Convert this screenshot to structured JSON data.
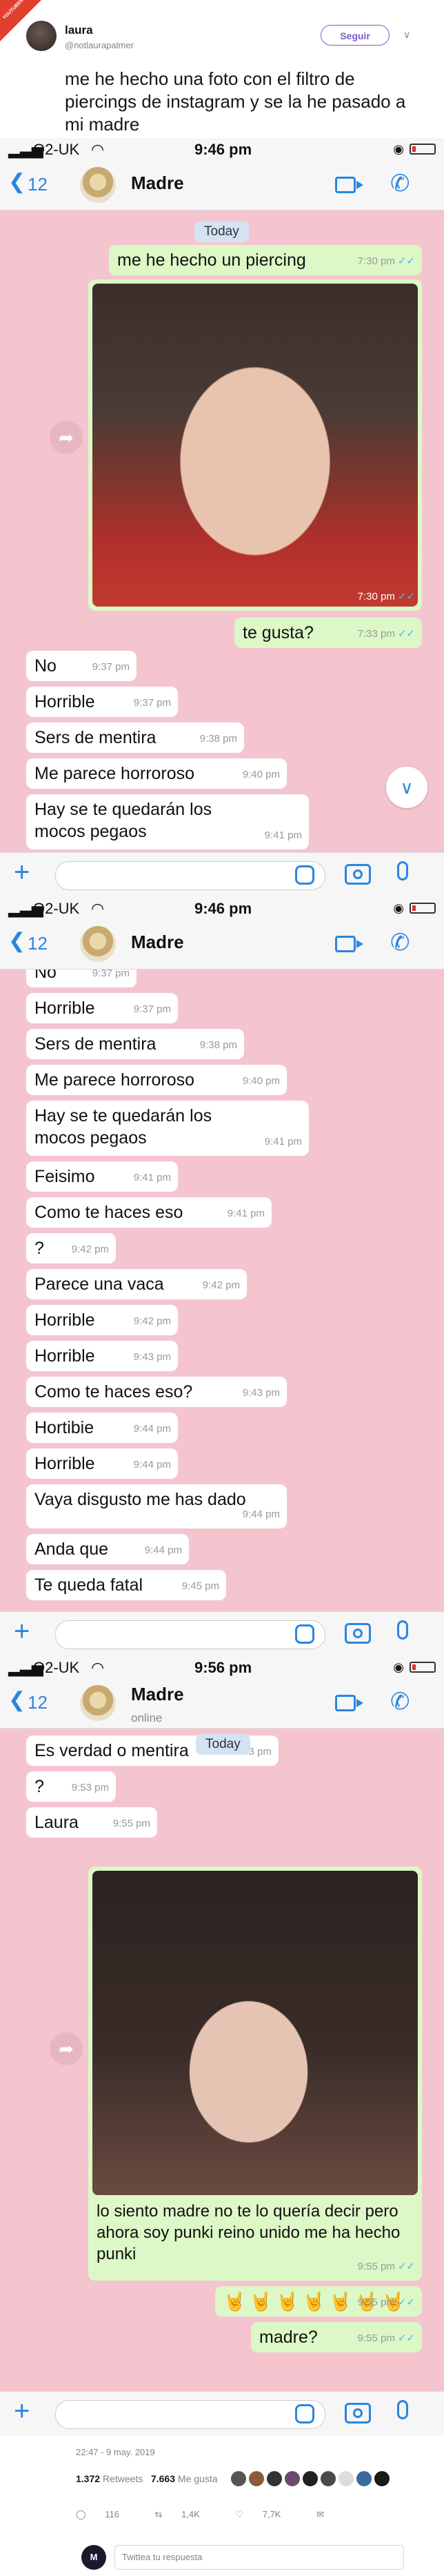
{
  "tweet": {
    "site_tag": "YOUTUBER.ES",
    "user_name": "laura",
    "handle": "@notlaurapalmer",
    "follow_label": "Seguir",
    "text": "me he hecho una foto con el filtro de piercings de instagram y se la he pasado a mi madre"
  },
  "screens": [
    {
      "carrier": "O2-UK",
      "time": "9:46 pm",
      "back_count": "12",
      "contact": "Madre",
      "contact_sub": "",
      "today": "Today",
      "messages": [
        {
          "text": "me he hecho un piercing",
          "time": "7:30 pm"
        },
        {
          "text": "",
          "time": "7:30 pm"
        },
        {
          "text": "te gusta?",
          "time": "7:33 pm"
        },
        {
          "text": "No",
          "time": "9:37 pm"
        },
        {
          "text": "Horrible",
          "time": "9:37 pm"
        },
        {
          "text": "Sers de mentira",
          "time": "9:38 pm"
        },
        {
          "text": "Me parece horroroso",
          "time": "9:40 pm"
        },
        {
          "text": "Hay se te quedarán los mocos pegaos",
          "time": "9:41 pm"
        }
      ]
    },
    {
      "carrier": "O2-UK",
      "time": "9:46 pm",
      "back_count": "12",
      "contact": "Madre",
      "contact_sub": "",
      "messages": [
        {
          "text": "No",
          "time": "9:37 pm"
        },
        {
          "text": "Horrible",
          "time": "9:37 pm"
        },
        {
          "text": "Sers de mentira",
          "time": "9:38 pm"
        },
        {
          "text": "Me parece horroroso",
          "time": "9:40 pm"
        },
        {
          "text": "Hay se te quedarán los mocos pegaos",
          "time": "9:41 pm"
        },
        {
          "text": "Feisimo",
          "time": "9:41 pm"
        },
        {
          "text": "Como te haces eso",
          "time": "9:41 pm"
        },
        {
          "text": "?",
          "time": "9:42 pm"
        },
        {
          "text": "Parece una vaca",
          "time": "9:42 pm"
        },
        {
          "text": "Horrible",
          "time": "9:42 pm"
        },
        {
          "text": "Horrible",
          "time": "9:43 pm"
        },
        {
          "text": "Como te haces  eso?",
          "time": "9:43 pm"
        },
        {
          "text": "Hortibie",
          "time": "9:44 pm"
        },
        {
          "text": "Horrible",
          "time": "9:44 pm"
        },
        {
          "text": "Vaya disgusto me has dado",
          "time": "9:44 pm"
        },
        {
          "text": "Anda que",
          "time": "9:44 pm"
        },
        {
          "text": "Te queda fatal",
          "time": "9:45 pm"
        }
      ]
    },
    {
      "carrier": "O2-UK",
      "time": "9:56 pm",
      "back_count": "12",
      "contact": "Madre",
      "contact_sub": "online",
      "today": "Today",
      "messages": [
        {
          "text": "Es verdad o mentira",
          "time": "9:53 pm"
        },
        {
          "text": "?",
          "time": "9:53 pm"
        },
        {
          "text": "Laura",
          "time": "9:55 pm"
        },
        {
          "text": "lo siento madre no te lo quería decir pero ahora soy punki reino unido me ha hecho punki",
          "time": "9:55 pm"
        },
        {
          "text": "🤘🤘🤘🤘🤘🤘🤘",
          "time": "9:55 pm"
        },
        {
          "text": "madre?",
          "time": "9:55 pm"
        }
      ]
    }
  ],
  "footer": {
    "date": "22:47 - 9 may. 2019",
    "retweets_count": "1.372",
    "retweets_label": "Retweets",
    "likes_count": "7.663",
    "likes_label": "Me gusta",
    "replies": "116",
    "rts": "1,4K",
    "likes": "7,7K",
    "reply_placeholder": "Twittea tu respuesta",
    "reply_avatar": "M"
  },
  "colors": {
    "chat_bg": "#f4c5cf",
    "outgoing": "#dcf8c6",
    "incoming": "#ffffff",
    "accent": "#2a86e0"
  }
}
